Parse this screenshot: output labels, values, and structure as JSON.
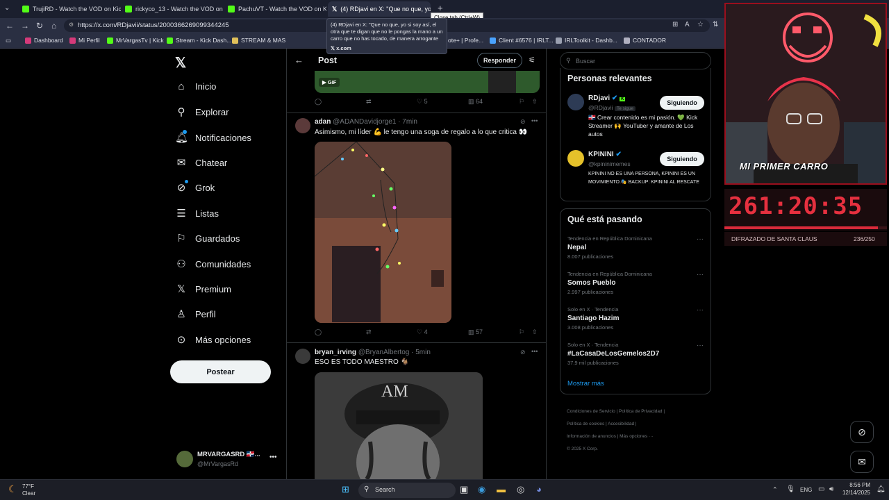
{
  "browser": {
    "tabs": [
      {
        "label": "TrujiRD - Watch the VOD on Kick",
        "icon": "kick-icon",
        "color": "#53fc18"
      },
      {
        "label": "rickyco_13 - Watch the VOD on Ki",
        "icon": "kick-icon",
        "color": "#53fc18"
      },
      {
        "label": "PachuVT - Watch the VOD on Kick",
        "icon": "kick-icon",
        "color": "#53fc18"
      },
      {
        "label": "(4) RDjavi en X: \"Que no que, yo s",
        "icon": "x-icon",
        "color": "#ffffff"
      }
    ],
    "new_tab": "+",
    "close_tab_tooltip": "Close tab (Ctrl+W)",
    "hover_card": {
      "title": "(4) RDjavi en X: \"Que no que, yo si soy así, el otra que te digan que no le pongas la mano a un carro que no has tocado, de manera arrogante ...",
      "domain": "x.com"
    },
    "url": "https://x.com/RDjavii/status/2000366269099344245",
    "bookmarks": [
      {
        "label": "Dashboard",
        "color": "#d63a7a"
      },
      {
        "label": "Mi Perfil",
        "color": "#d63a7a"
      },
      {
        "label": "MrVargasTv | Kick",
        "color": "#53fc18"
      },
      {
        "label": "Stream - Kick Dash...",
        "color": "#53fc18"
      },
      {
        "label": "STREAM & MAS",
        "color": "#e0c05a"
      },
      {
        "label": "ote+ | Profe...",
        "color": "#888888"
      },
      {
        "label": "Client #6576 | IRLT...",
        "color": "#4aa3ff"
      },
      {
        "label": "IRLToolkit - Dashb...",
        "color": "#9aa0b0"
      },
      {
        "label": "CONTADOR",
        "color": "#b0b0c0"
      }
    ]
  },
  "nav": {
    "items": [
      {
        "label": "Inicio",
        "icon": "home-icon"
      },
      {
        "label": "Explorar",
        "icon": "search-icon"
      },
      {
        "label": "Notificaciones",
        "icon": "bell-icon"
      },
      {
        "label": "Chatear",
        "icon": "mail-icon"
      },
      {
        "label": "Grok",
        "icon": "grok-icon"
      },
      {
        "label": "Listas",
        "icon": "list-icon"
      },
      {
        "label": "Guardados",
        "icon": "bookmark-icon"
      },
      {
        "label": "Comunidades",
        "icon": "people-icon"
      },
      {
        "label": "Premium",
        "icon": "x-icon"
      },
      {
        "label": "Perfil",
        "icon": "person-icon"
      },
      {
        "label": "Más opciones",
        "icon": "more-circle-icon"
      }
    ],
    "post_button": "Postear",
    "account": {
      "name": "MRVARGASRD 🇩🇴...",
      "handle": "@MrVargasRd"
    }
  },
  "post_header": {
    "title": "Post",
    "reply_button": "Responder"
  },
  "gif_badge": "GIF",
  "tweets": [
    {
      "likes": "5",
      "views": "64"
    },
    {
      "name": "adan",
      "handle": "@ADANDavidjorge1 · 7min",
      "text": "Asimismo, mi líder 💪 le tengo una soga de regalo a lo que critica 👀",
      "likes": "4",
      "views": "57"
    },
    {
      "name": "bryan_irving",
      "handle": "@BryanAlbertog · 5min",
      "text": "ESO ES TODO MAESTRO 🐐"
    }
  ],
  "right": {
    "search_placeholder": "Buscar",
    "relevant_title": "Personas relevantes",
    "people": [
      {
        "name": "RDjavi",
        "handle": "@RDjavii",
        "follows_you": "Te sigue",
        "button": "Siguiendo",
        "bio": "🇩🇴 Crear contenido es mi pasión. 💚 Kick Streamer 🙌 YouTuber y amante de Los autos"
      },
      {
        "name": "KPININI",
        "handle": "@kpininimemes",
        "button": "Siguiendo",
        "bio": "KPININI NO ES UNA PERSONA, KPININI ES UN MOVIMIENTO.🎭 BACKUP: KPININI AL RESCATE"
      }
    ],
    "trending_title": "Qué está pasando",
    "trends": [
      {
        "context": "Tendencia en República Dominicana",
        "title": "Nepal",
        "count": "8.007 publicaciones"
      },
      {
        "context": "Tendencia en República Dominicana",
        "title": "Somos Pueblo",
        "count": "2.997 publicaciones"
      },
      {
        "context": "Solo en X · Tendencia",
        "title": "Santiago Hazim",
        "count": "3.008 publicaciones"
      },
      {
        "context": "Solo en X · Tendencia",
        "title": "#LaCasaDeLosGemelos2D7",
        "count": "37,9 mil publicaciones"
      }
    ],
    "show_more": "Mostrar más",
    "footer": [
      "Condiciones de Servicio",
      "Política de Privacidad",
      "Política de cookies",
      "Accesibilidad",
      "Información de anuncios",
      "Más opciones ···",
      "© 2025 X Corp."
    ]
  },
  "stream_overlay": {
    "banner": "MI PRIMER CARRO",
    "timer": "261:20:35",
    "goal_label": "DIFRAZADO DE SANTA CLAUS",
    "goal_count": "236/250",
    "goal_progress": 0.944
  },
  "taskbar": {
    "weather_temp": "77°F",
    "weather_desc": "Clear",
    "search": "Search",
    "lang": "ENG",
    "time": "8:56 PM",
    "date": "12/14/2025"
  }
}
